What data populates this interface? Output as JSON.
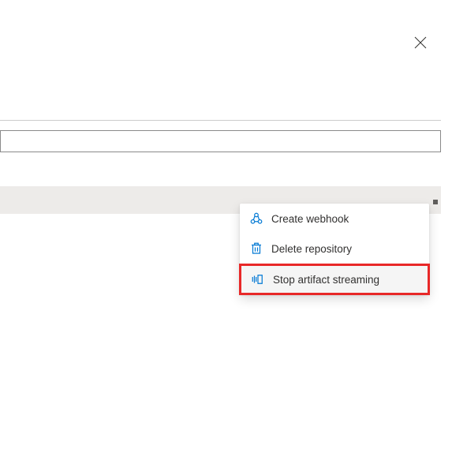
{
  "menu": {
    "items": [
      {
        "label": "Create webhook"
      },
      {
        "label": "Delete repository"
      },
      {
        "label": "Stop artifact streaming"
      }
    ]
  }
}
